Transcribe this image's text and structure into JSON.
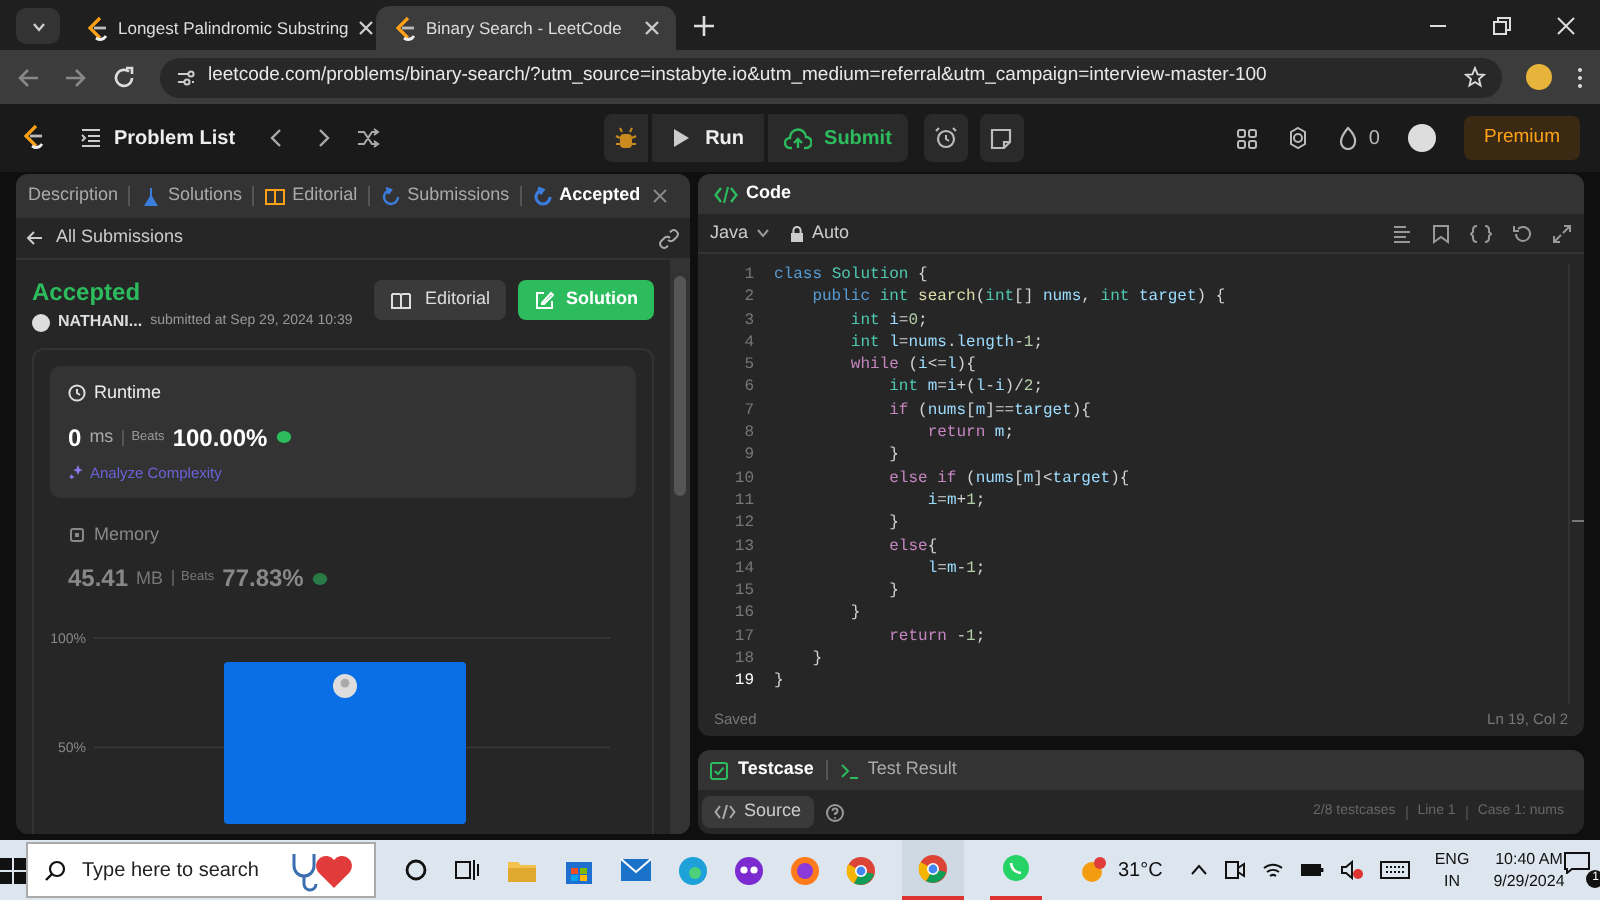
{
  "browser": {
    "tabs": [
      {
        "title": "Longest Palindromic Substring",
        "selected": false
      },
      {
        "title": "Binary Search - LeetCode",
        "selected": true
      }
    ],
    "url": "leetcode.com/problems/binary-search/?utm_source=instabyte.io&utm_medium=referral&utm_campaign=interview-master-100"
  },
  "nav": {
    "problem_list": "Problem List",
    "run": "Run",
    "submit": "Submit",
    "streak": "0",
    "premium": "Premium"
  },
  "left_panel": {
    "tabs": [
      {
        "label": "Description",
        "selected": false
      },
      {
        "label": "Solutions",
        "selected": false
      },
      {
        "label": "Editorial",
        "selected": false
      },
      {
        "label": "Submissions",
        "selected": false
      },
      {
        "label": "Accepted",
        "selected": true
      }
    ],
    "back_link": "All Submissions",
    "status": "Accepted",
    "user": "NATHANI...",
    "submitted": "submitted at Sep 29, 2024 10:39",
    "buttons": [
      "Editorial",
      "Solution"
    ],
    "runtime": {
      "title": "Runtime",
      "value": "0",
      "unit": "ms",
      "beats_label": "Beats",
      "beats": "100.00%",
      "analyze": "Analyze Complexity"
    },
    "memory": {
      "title": "Memory",
      "value": "45.41",
      "unit": "MB",
      "beats_label": "Beats",
      "beats": "77.83%",
      "chart_data": {
        "type": "bar",
        "values": [
          89
        ],
        "ylim": [
          15,
          100
        ],
        "yticks": [
          {
            "value": 50,
            "label": "50%"
          },
          {
            "value": 100,
            "label": "100%"
          }
        ]
      }
    }
  },
  "code_panel": {
    "title": "Code",
    "language": "Java",
    "mode": "Auto",
    "lines": [
      {
        "number": "1",
        "tokens": [
          {
            "text": "class",
            "kind": "kw"
          },
          {
            "text": " Solution",
            "kind": "type"
          },
          {
            "text": " {",
            "kind": "p"
          }
        ]
      },
      {
        "number": "2",
        "tokens": [
          {
            "text": "    public",
            "kind": "kw"
          },
          {
            "text": " int",
            "kind": "type"
          },
          {
            "text": " search",
            "kind": "fn"
          },
          {
            "text": "(",
            "kind": "p"
          },
          {
            "text": "int",
            "kind": "type"
          },
          {
            "text": "[] ",
            "kind": "p"
          },
          {
            "text": "nums",
            "kind": "var"
          },
          {
            "text": ", ",
            "kind": "p"
          },
          {
            "text": "int",
            "kind": "type"
          },
          {
            "text": " target",
            "kind": "var"
          },
          {
            "text": ") {",
            "kind": "p"
          }
        ]
      },
      {
        "number": "3",
        "tokens": [
          {
            "text": "        int",
            "kind": "type"
          },
          {
            "text": " i",
            "kind": "var"
          },
          {
            "text": "=",
            "kind": "p"
          },
          {
            "text": "0",
            "kind": "num"
          },
          {
            "text": ";",
            "kind": "p"
          }
        ]
      },
      {
        "number": "4",
        "tokens": [
          {
            "text": "        int",
            "kind": "type"
          },
          {
            "text": " l",
            "kind": "var"
          },
          {
            "text": "=",
            "kind": "p"
          },
          {
            "text": "nums",
            "kind": "var"
          },
          {
            "text": ".",
            "kind": "p"
          },
          {
            "text": "length",
            "kind": "var"
          },
          {
            "text": "-",
            "kind": "p"
          },
          {
            "text": "1",
            "kind": "num"
          },
          {
            "text": ";",
            "kind": "p"
          }
        ]
      },
      {
        "number": "5",
        "tokens": [
          {
            "text": "        while",
            "kind": "ctl"
          },
          {
            "text": " (",
            "kind": "p"
          },
          {
            "text": "i",
            "kind": "var"
          },
          {
            "text": "<=",
            "kind": "p"
          },
          {
            "text": "l",
            "kind": "var"
          },
          {
            "text": "){",
            "kind": "p"
          }
        ]
      },
      {
        "number": "6",
        "tokens": [
          {
            "text": "            int",
            "kind": "type"
          },
          {
            "text": " m",
            "kind": "var"
          },
          {
            "text": "=",
            "kind": "p"
          },
          {
            "text": "i",
            "kind": "var"
          },
          {
            "text": "+(",
            "kind": "p"
          },
          {
            "text": "l",
            "kind": "var"
          },
          {
            "text": "-",
            "kind": "p"
          },
          {
            "text": "i",
            "kind": "var"
          },
          {
            "text": ")/",
            "kind": "p"
          },
          {
            "text": "2",
            "kind": "num"
          },
          {
            "text": ";",
            "kind": "p"
          }
        ]
      },
      {
        "number": "7",
        "tokens": [
          {
            "text": "            if",
            "kind": "ctl"
          },
          {
            "text": " (",
            "kind": "p"
          },
          {
            "text": "nums",
            "kind": "var"
          },
          {
            "text": "[",
            "kind": "p"
          },
          {
            "text": "m",
            "kind": "var"
          },
          {
            "text": "]==",
            "kind": "p"
          },
          {
            "text": "target",
            "kind": "var"
          },
          {
            "text": "){",
            "kind": "p"
          }
        ]
      },
      {
        "number": "8",
        "tokens": [
          {
            "text": "                return",
            "kind": "ctl"
          },
          {
            "text": " m",
            "kind": "var"
          },
          {
            "text": ";",
            "kind": "p"
          }
        ]
      },
      {
        "number": "9",
        "tokens": [
          {
            "text": "            }",
            "kind": "p"
          }
        ]
      },
      {
        "number": "10",
        "tokens": [
          {
            "text": "            else",
            "kind": "ctl"
          },
          {
            "text": " if",
            "kind": "ctl"
          },
          {
            "text": " (",
            "kind": "p"
          },
          {
            "text": "nums",
            "kind": "var"
          },
          {
            "text": "[",
            "kind": "p"
          },
          {
            "text": "m",
            "kind": "var"
          },
          {
            "text": "]<",
            "kind": "p"
          },
          {
            "text": "target",
            "kind": "var"
          },
          {
            "text": "){",
            "kind": "p"
          }
        ]
      },
      {
        "number": "11",
        "tokens": [
          {
            "text": "                i",
            "kind": "var"
          },
          {
            "text": "=",
            "kind": "p"
          },
          {
            "text": "m",
            "kind": "var"
          },
          {
            "text": "+",
            "kind": "p"
          },
          {
            "text": "1",
            "kind": "num"
          },
          {
            "text": ";",
            "kind": "p"
          }
        ]
      },
      {
        "number": "12",
        "tokens": [
          {
            "text": "            }",
            "kind": "p"
          }
        ]
      },
      {
        "number": "13",
        "tokens": [
          {
            "text": "            else",
            "kind": "ctl"
          },
          {
            "text": "{",
            "kind": "p"
          }
        ]
      },
      {
        "number": "14",
        "tokens": [
          {
            "text": "                l",
            "kind": "var"
          },
          {
            "text": "=",
            "kind": "p"
          },
          {
            "text": "m",
            "kind": "var"
          },
          {
            "text": "-",
            "kind": "p"
          },
          {
            "text": "1",
            "kind": "num"
          },
          {
            "text": ";",
            "kind": "p"
          }
        ]
      },
      {
        "number": "15",
        "tokens": [
          {
            "text": "            }",
            "kind": "p"
          }
        ]
      },
      {
        "number": "16",
        "tokens": [
          {
            "text": "        }",
            "kind": "p"
          }
        ]
      },
      {
        "number": "17",
        "tokens": [
          {
            "text": "            return",
            "kind": "ctl"
          },
          {
            "text": " -",
            "kind": "p"
          },
          {
            "text": "1",
            "kind": "num"
          },
          {
            "text": ";",
            "kind": "p"
          }
        ]
      },
      {
        "number": "18",
        "tokens": [
          {
            "text": "    }",
            "kind": "p"
          }
        ]
      },
      {
        "number": "19",
        "tokens": [
          {
            "text": "}",
            "kind": "p"
          }
        ]
      }
    ],
    "saved": "Saved",
    "cursor": "Ln 19, Col 2"
  },
  "testcase_panel": {
    "tabs": [
      {
        "label": "Testcase",
        "selected": true
      },
      {
        "label": "Test Result",
        "selected": false
      }
    ],
    "source": "Source",
    "testcases": "2/8 testcases",
    "line": "Line 1",
    "case": "Case 1: nums"
  },
  "taskbar": {
    "search_placeholder": "Type here to search",
    "weather": "31°C",
    "language": "ENG",
    "region": "IN",
    "time": "10:40 AM",
    "date": "9/29/2024",
    "notifications": "1"
  }
}
